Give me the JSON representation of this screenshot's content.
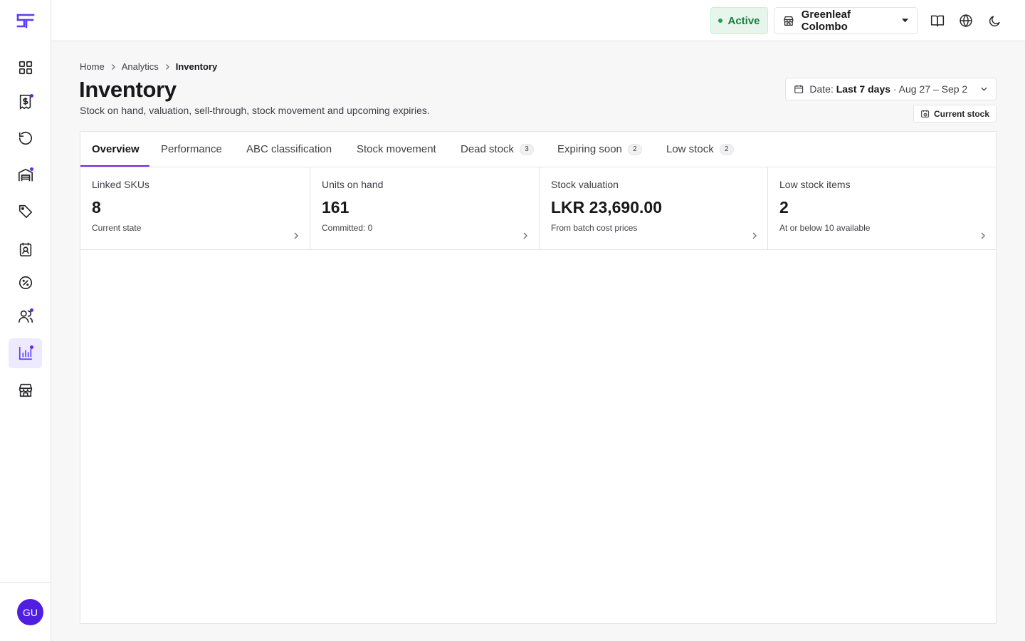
{
  "sidebar": {
    "logo": "SF",
    "items": [
      {
        "name": "dashboard",
        "icon": "grid-icon",
        "dot": false,
        "active": false
      },
      {
        "name": "sales",
        "icon": "receipt-dollar-icon",
        "dot": true,
        "active": false
      },
      {
        "name": "returns",
        "icon": "rotate-ccw-icon",
        "dot": false,
        "active": false
      },
      {
        "name": "inventory",
        "icon": "warehouse-icon",
        "dot": true,
        "active": false
      },
      {
        "name": "products",
        "icon": "tag-icon",
        "dot": false,
        "active": false
      },
      {
        "name": "contacts",
        "icon": "contact-icon",
        "dot": false,
        "active": false
      },
      {
        "name": "discounts",
        "icon": "badge-percent-icon",
        "dot": false,
        "active": false
      },
      {
        "name": "customers",
        "icon": "users-icon",
        "dot": true,
        "active": false
      },
      {
        "name": "analytics",
        "icon": "bar-chart-icon",
        "dot": true,
        "active": true
      },
      {
        "name": "stores",
        "icon": "store-icon",
        "dot": false,
        "active": false
      }
    ],
    "avatar_initials": "GU"
  },
  "topbar": {
    "status": "Active",
    "store_name": "Greenleaf Colombo",
    "icons": [
      "book-open-icon",
      "globe-icon",
      "moon-icon"
    ]
  },
  "breadcrumb": {
    "items": [
      "Home",
      "Analytics"
    ],
    "current": "Inventory"
  },
  "page": {
    "title": "Inventory",
    "subtitle": "Stock on hand, valuation, sell-through, stock movement and upcoming expiries."
  },
  "date_picker": {
    "prefix": "Date:",
    "range_label": "Last 7 days",
    "range_dates": "· Aug 27 – Sep 2"
  },
  "current_stock_label": "Current stock",
  "tabs": [
    {
      "label": "Overview",
      "count": null,
      "active": true
    },
    {
      "label": "Performance",
      "count": null,
      "active": false
    },
    {
      "label": "ABC classification",
      "count": null,
      "active": false
    },
    {
      "label": "Stock movement",
      "count": null,
      "active": false
    },
    {
      "label": "Dead stock",
      "count": "3",
      "active": false
    },
    {
      "label": "Expiring soon",
      "count": "2",
      "active": false
    },
    {
      "label": "Low stock",
      "count": "2",
      "active": false
    }
  ],
  "kpis": [
    {
      "label": "Linked SKUs",
      "value": "8",
      "sub": "Current state"
    },
    {
      "label": "Units on hand",
      "value": "161",
      "sub": "Committed: 0"
    },
    {
      "label": "Stock valuation",
      "value": "LKR 23,690.00",
      "sub": "From batch cost prices"
    },
    {
      "label": "Low stock items",
      "value": "2",
      "sub": "At or below 10 available"
    }
  ],
  "colors": {
    "accent": "#6d28d9",
    "active_status": "#15803d",
    "avatar_bg": "#4f1ee0"
  }
}
